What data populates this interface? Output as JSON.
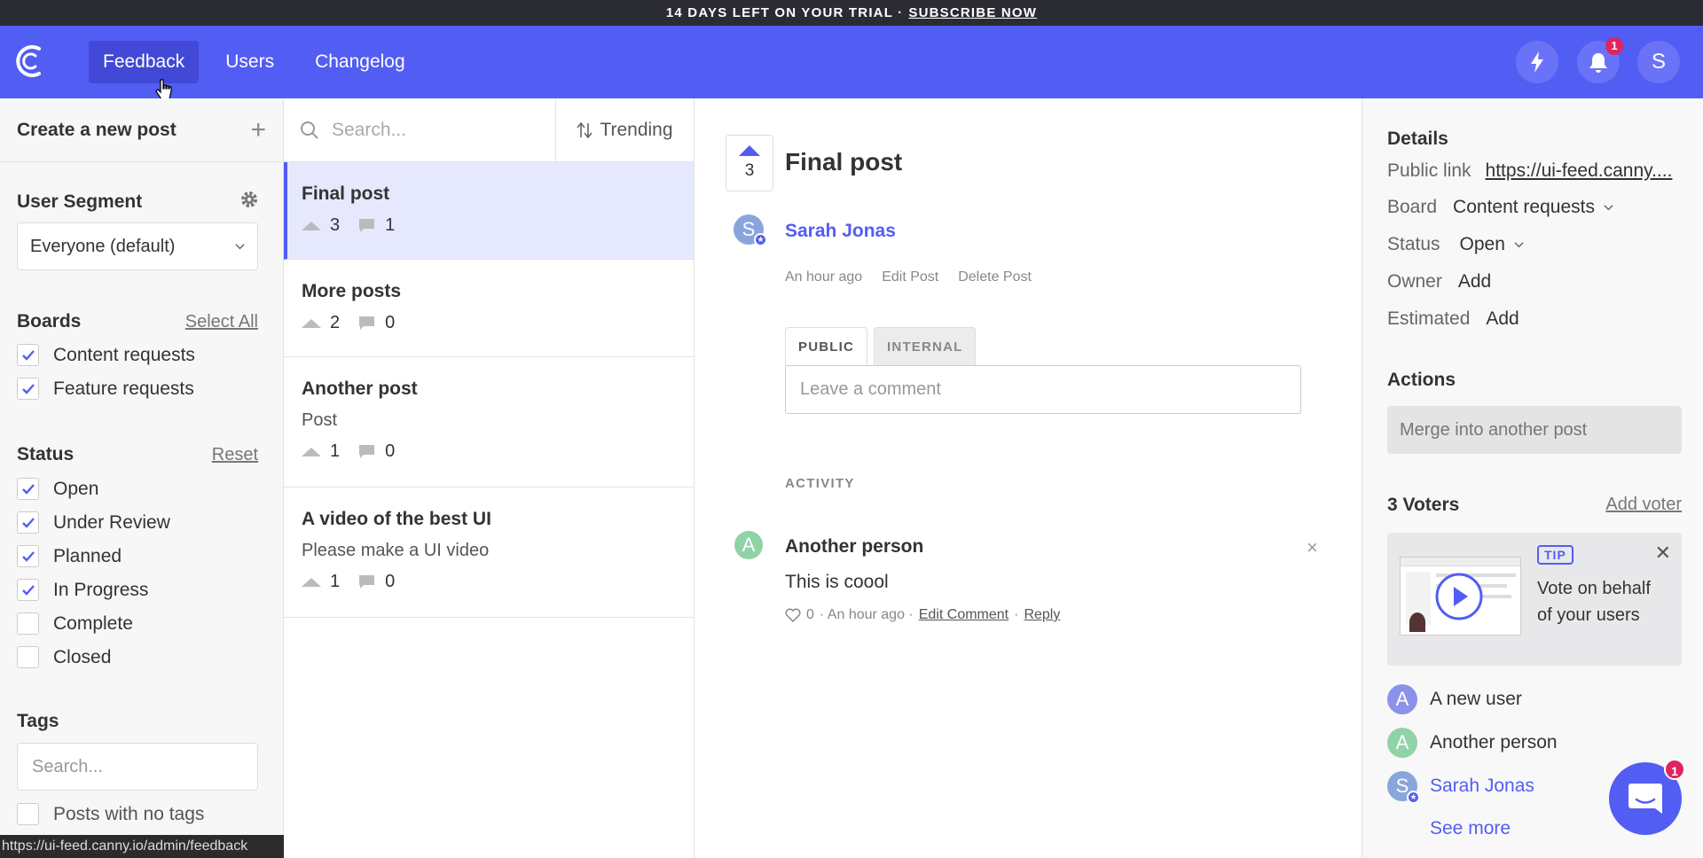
{
  "trial": {
    "text": "14 DAYS LEFT ON YOUR TRIAL ·",
    "cta": "SUBSCRIBE NOW"
  },
  "header": {
    "nav": [
      "Feedback",
      "Users",
      "Changelog"
    ],
    "notification_count": "1",
    "avatar_letter": "S"
  },
  "sidebar": {
    "create_label": "Create a new post",
    "segment_title": "User Segment",
    "segment_value": "Everyone (default)",
    "boards_title": "Boards",
    "boards_link": "Select All",
    "boards": [
      {
        "label": "Content requests",
        "checked": true
      },
      {
        "label": "Feature requests",
        "checked": true
      }
    ],
    "status_title": "Status",
    "status_link": "Reset",
    "statuses": [
      {
        "label": "Open",
        "checked": true
      },
      {
        "label": "Under Review",
        "checked": true
      },
      {
        "label": "Planned",
        "checked": true
      },
      {
        "label": "In Progress",
        "checked": true
      },
      {
        "label": "Complete",
        "checked": false
      },
      {
        "label": "Closed",
        "checked": false
      }
    ],
    "tags_title": "Tags",
    "tags_placeholder": "Search...",
    "no_tags_label": "Posts with no tags",
    "status_url": "https://ui-feed.canny.io/admin/feedback"
  },
  "list": {
    "search_placeholder": "Search...",
    "sort_label": "Trending",
    "posts": [
      {
        "title": "Final post",
        "desc": "",
        "votes": "3",
        "comments": "1"
      },
      {
        "title": "More posts",
        "desc": "",
        "votes": "2",
        "comments": "0"
      },
      {
        "title": "Another post",
        "desc": "Post",
        "votes": "1",
        "comments": "0"
      },
      {
        "title": "A video of the best UI",
        "desc": "Please make a UI video",
        "votes": "1",
        "comments": "0"
      }
    ]
  },
  "post": {
    "votes": "3",
    "title": "Final post",
    "author_initial": "S",
    "author": "Sarah Jonas",
    "time": "An hour ago",
    "edit": "Edit Post",
    "delete": "Delete Post",
    "tab_public": "PUBLIC",
    "tab_internal": "INTERNAL",
    "comment_placeholder": "Leave a comment",
    "activity_label": "ACTIVITY",
    "comment": {
      "initial": "A",
      "author": "Another person",
      "text": "This is coool",
      "likes": "0",
      "time": "· An hour ago ·",
      "edit": "Edit Comment",
      "sep": "·",
      "reply": "Reply"
    }
  },
  "details": {
    "title": "Details",
    "public_link_label": "Public link",
    "public_link": "https://ui-feed.canny....",
    "board_label": "Board",
    "board_value": "Content requests",
    "status_label": "Status",
    "status_value": "Open",
    "owner_label": "Owner",
    "owner_value": "Add",
    "estimated_label": "Estimated",
    "estimated_value": "Add",
    "actions_title": "Actions",
    "merge_label": "Merge into another post",
    "voters_title": "3 Voters",
    "add_voter": "Add voter",
    "tip_tag": "TIP",
    "tip_text": "Vote on behalf of your users",
    "voters": [
      {
        "initial": "A",
        "name": "A new user",
        "color": "#8b93e8"
      },
      {
        "initial": "A",
        "name": "Another person",
        "color": "#8fd3a6"
      },
      {
        "initial": "S",
        "name": "Sarah Jonas",
        "color": "#8aa5dc"
      }
    ],
    "see_more": "See more",
    "chat_badge": "1"
  },
  "colors": {
    "brand": "#525df4",
    "banner": "#2b2b33",
    "badge": "#e0245e"
  }
}
